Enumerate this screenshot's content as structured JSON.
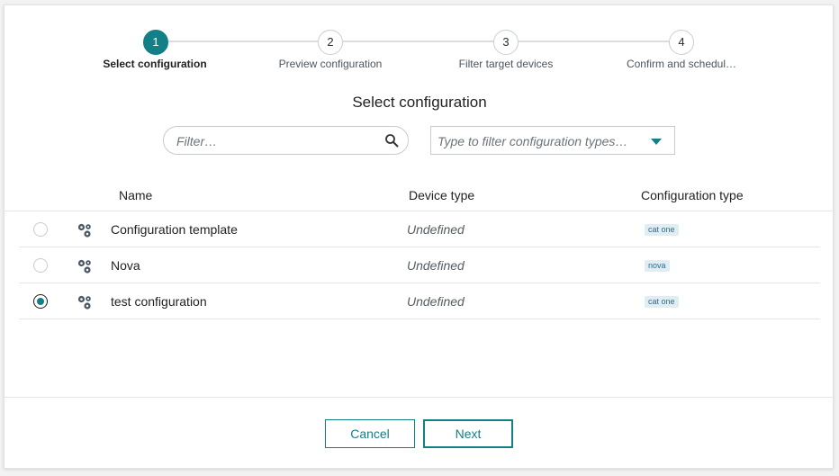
{
  "stepper": {
    "steps": [
      {
        "number": "1",
        "label": "Select configuration"
      },
      {
        "number": "2",
        "label": "Preview configuration"
      },
      {
        "number": "3",
        "label": "Filter target devices"
      },
      {
        "number": "4",
        "label": "Confirm and schedul…"
      }
    ],
    "active_step": 1
  },
  "title": "Select configuration",
  "filters": {
    "name_placeholder": "Filter…",
    "type_placeholder": "Type to filter configuration types…"
  },
  "table": {
    "columns": {
      "name": "Name",
      "device_type": "Device type",
      "configuration_type": "Configuration type"
    },
    "rows": [
      {
        "name": "Configuration template",
        "device_type": "Undefined",
        "configuration_type": "cat one",
        "selected": false
      },
      {
        "name": "Nova",
        "device_type": "Undefined",
        "configuration_type": "nova",
        "selected": false
      },
      {
        "name": "test configuration",
        "device_type": "Undefined",
        "configuration_type": "cat one",
        "selected": true
      }
    ]
  },
  "footer": {
    "cancel_label": "Cancel",
    "next_label": "Next"
  },
  "colors": {
    "accent": "#137f87",
    "badge_bg": "#e1edf5",
    "badge_text": "#1f6f98"
  },
  "icons": {
    "row_icon": "cogs-icon",
    "search": "search-icon",
    "dropdown": "caret-down-icon"
  }
}
